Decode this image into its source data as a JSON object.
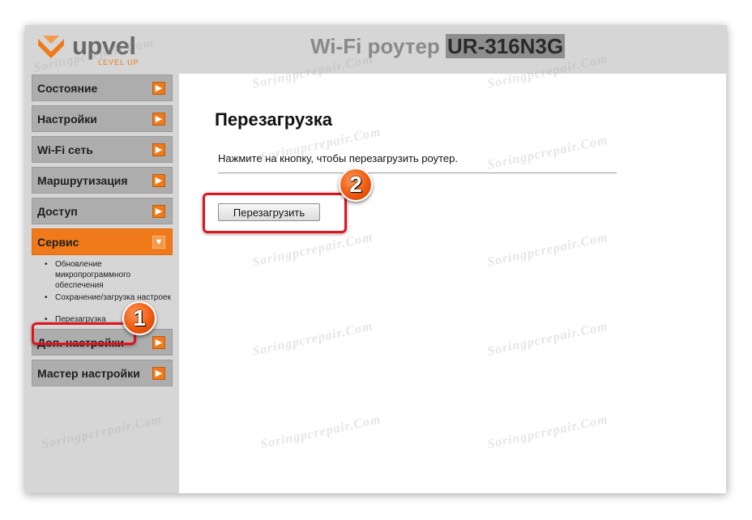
{
  "header": {
    "logo_text": "upvel",
    "logo_subtext": "LEVEL UP",
    "title": "Wi-Fi роутер",
    "model": "UR-316N3G"
  },
  "sidebar": {
    "items": [
      {
        "label": "Состояние"
      },
      {
        "label": "Настройки"
      },
      {
        "label": "Wi-Fi сеть"
      },
      {
        "label": "Маршрутизация"
      },
      {
        "label": "Доступ"
      },
      {
        "label": "Сервис"
      },
      {
        "label": "Доп. настройки"
      },
      {
        "label": "Мастер настройки"
      }
    ],
    "submenu": [
      {
        "label": "Обновление микропрограммного обеспечения"
      },
      {
        "label": "Сохранение/загрузка настроек"
      },
      {
        "label": "Перезагрузка"
      }
    ]
  },
  "main": {
    "title": "Перезагрузка",
    "description": "Нажмите на кнопку, чтобы перезагрузить роутер.",
    "reboot_button": "Перезагрузить"
  },
  "annotations": {
    "badge_1": "1",
    "badge_2": "2"
  },
  "watermark": {
    "text": "Soringpcrepair.Com"
  },
  "colors": {
    "accent": "#f07a1a",
    "highlight": "#e0141e",
    "sidebar_button": "#adadad",
    "frame_bg": "#d6d6d6"
  }
}
